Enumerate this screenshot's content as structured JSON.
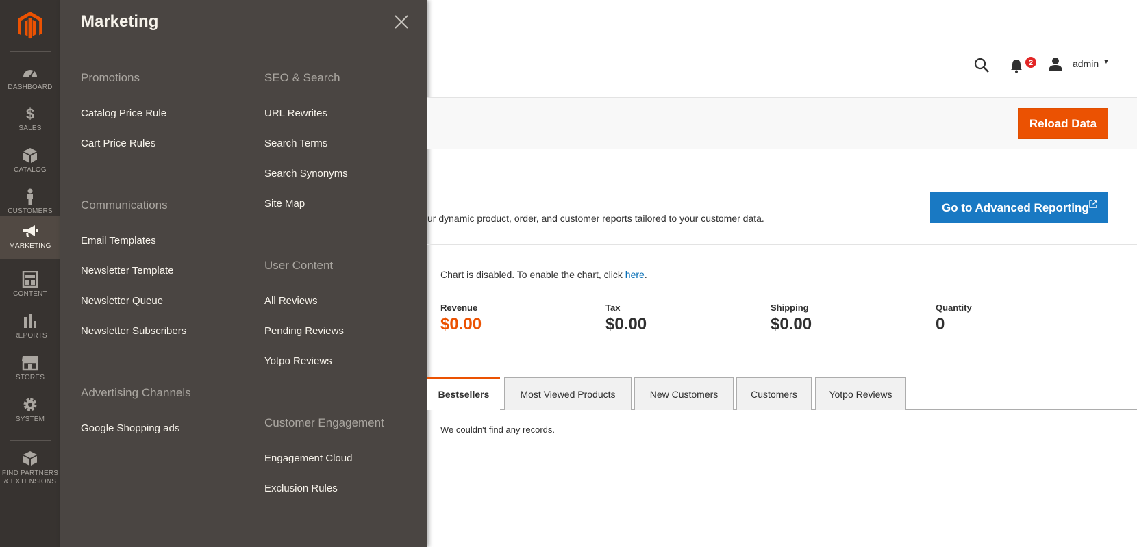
{
  "rail": {
    "items": [
      {
        "label": "DASHBOARD",
        "icon": "dashboard-icon"
      },
      {
        "label": "SALES",
        "icon": "dollar-icon"
      },
      {
        "label": "CATALOG",
        "icon": "box-icon"
      },
      {
        "label": "CUSTOMERS",
        "icon": "person-icon"
      },
      {
        "label": "MARKETING",
        "icon": "megaphone-icon"
      },
      {
        "label": "CONTENT",
        "icon": "layout-icon"
      },
      {
        "label": "REPORTS",
        "icon": "bar-chart-icon"
      },
      {
        "label": "STORES",
        "icon": "storefront-icon"
      },
      {
        "label": "SYSTEM",
        "icon": "gear-icon"
      }
    ],
    "partners_line1": "FIND PARTNERS",
    "partners_line2": "& EXTENSIONS"
  },
  "panel": {
    "title": "Marketing",
    "promotions": {
      "title": "Promotions",
      "items": [
        "Catalog Price Rule",
        "Cart Price Rules"
      ]
    },
    "communications": {
      "title": "Communications",
      "items": [
        "Email Templates",
        "Newsletter Template",
        "Newsletter Queue",
        "Newsletter Subscribers"
      ]
    },
    "advertising": {
      "title": "Advertising Channels",
      "items": [
        "Google Shopping ads"
      ]
    },
    "seo": {
      "title": "SEO & Search",
      "items": [
        "URL Rewrites",
        "Search Terms",
        "Search Synonyms",
        "Site Map"
      ]
    },
    "user_content": {
      "title": "User Content",
      "items": [
        "All Reviews",
        "Pending Reviews",
        "Yotpo Reviews"
      ]
    },
    "engagement": {
      "title": "Customer Engagement",
      "items": [
        "Engagement Cloud",
        "Exclusion Rules"
      ]
    }
  },
  "header": {
    "notification_count": "2",
    "user": "admin"
  },
  "actions": {
    "reload": "Reload Data"
  },
  "advanced": {
    "description": "ur dynamic product, order, and customer reports tailored to your customer data.",
    "button": "Go to Advanced Reporting"
  },
  "chart_note": {
    "text": "Chart is disabled. To enable the chart, click ",
    "link": "here",
    "tail": "."
  },
  "totals": [
    {
      "label": "Revenue",
      "value": "$0.00"
    },
    {
      "label": "Tax",
      "value": "$0.00"
    },
    {
      "label": "Shipping",
      "value": "$0.00"
    },
    {
      "label": "Quantity",
      "value": "0"
    }
  ],
  "tabs": [
    "Bestsellers",
    "Most Viewed Products",
    "New Customers",
    "Customers",
    "Yotpo Reviews"
  ],
  "empty_message": "We couldn't find any records.",
  "colors": {
    "accent": "#eb5202",
    "link": "#1979c3",
    "rail": "#373330",
    "panel": "#4a4542"
  }
}
